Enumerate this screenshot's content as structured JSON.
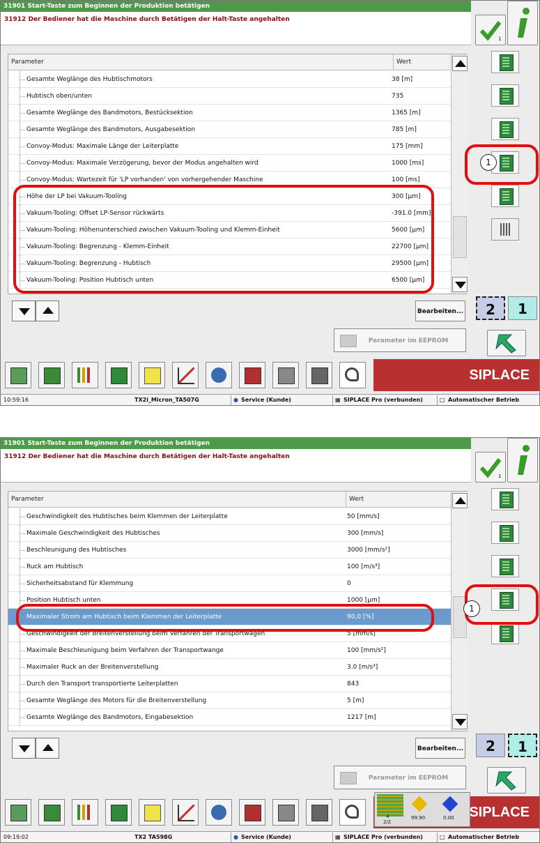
{
  "screen1": {
    "title": "31901 Start-Taste zum Beginnen der Produktion betätigen",
    "message": "31912 Der Bediener hat die Maschine durch Betätigen der Halt-Taste angehalten",
    "col_param": "Parameter",
    "col_value": "Wert",
    "rows": [
      {
        "name": "Gesamte Weglänge des Hubtischmotors",
        "value": "38 [m]"
      },
      {
        "name": "Hubtisch oben/unten",
        "value": "735"
      },
      {
        "name": "Gesamte Weglänge des Bandmotors, Bestücksektion",
        "value": "1365 [m]"
      },
      {
        "name": "Gesamte Weglänge des Bandmotors, Ausgabesektion",
        "value": "785 [m]"
      },
      {
        "name": "Convoy-Modus: Maximale Länge der Leiterplatte",
        "value": "175 [mm]"
      },
      {
        "name": "Convoy-Modus: Maximale Verzögerung, bevor der Modus angehalten wird",
        "value": "1000 [ms]"
      },
      {
        "name": "Convoy-Modus: Wartezeit für 'LP vorhanden' von vorhergehender Maschine",
        "value": "100 [ms]"
      },
      {
        "name": "Höhe der LP bei Vakuum-Tooling",
        "value": "300 [µm]"
      },
      {
        "name": "Vakuum-Tooling: Offset LP-Sensor rückwärts",
        "value": "-391.0 [mm]"
      },
      {
        "name": "Vakuum-Tooling: Höhenunterschied zwischen Vakuum-Tooling und Klemm-Einheit",
        "value": "5600 [µm]"
      },
      {
        "name": "Vakuum-Tooling: Begrenzung - Klemm-Einheit",
        "value": "22700 [µm]"
      },
      {
        "name": "Vakuum-Tooling: Begrenzung - Hubtisch",
        "value": "29500 [µm]"
      },
      {
        "name": "Vakuum-Tooling: Position Hubtisch unten",
        "value": "6500 [µm]"
      }
    ],
    "edit_label": "Bearbeiten...",
    "eeprom_label": "Parameter im EEPROM speichern",
    "page_2": "2",
    "page_1": "1",
    "check_sub": "1",
    "callout": "1",
    "brand": "SIPLACE",
    "status": {
      "time": "10:59:16",
      "machine": "TX2i_Micron_TA507G",
      "user": "Service (Kunde)",
      "connection": "SIPLACE Pro (verbunden)",
      "mode": "Automatischer Betrieb"
    }
  },
  "screen2": {
    "title": "31901 Start-Taste zum Beginnen der Produktion betätigen",
    "message": "31912 Der Bediener hat die Maschine durch Betätigen der Halt-Taste angehalten",
    "col_param": "Parameter",
    "col_value": "Wert",
    "rows": [
      {
        "name": "Geschwindigkeit des Hubtisches beim Klemmen der Leiterplatte",
        "value": "50 [mm/s]"
      },
      {
        "name": "Maximale Geschwindigkeit des Hubtisches",
        "value": "300 [mm/s]"
      },
      {
        "name": "Beschleunigung des Hubtisches",
        "value": "3000 [mm/s²]"
      },
      {
        "name": "Ruck am Hubtisch",
        "value": "100 [m/s³]"
      },
      {
        "name": "Sicherheitsabstand für Klemmung",
        "value": "0"
      },
      {
        "name": "Position Hubtisch unten",
        "value": "1000 [µm]"
      },
      {
        "name": "Maximaler Strom am Hubtisch beim Klemmen der Leiterplatte",
        "value": "90,0  [%]"
      },
      {
        "name": "Geschwindigkeit der Breitenverstellung beim Verfahren der Transportwagen",
        "value": "5 [mm/s]"
      },
      {
        "name": "Maximale Beschleunigung beim Verfahren der Transportwange",
        "value": "100 [mm/s²]"
      },
      {
        "name": "Maximaler Ruck an der Breitenverstellung",
        "value": "3.0 [m/s³]"
      },
      {
        "name": "Durch den Transport transportierte Leiterplatten",
        "value": "843"
      },
      {
        "name": "Gesamte Weglänge des Motors für die Breitenverstellung",
        "value": "5 [m]"
      },
      {
        "name": "Gesamte Weglänge des Bandmotors, Eingabesektion",
        "value": "1217 [m]"
      }
    ],
    "edit_label": "Bearbeiten...",
    "eeprom_label": "Parameter im EEPROM speichern",
    "page_2": "2",
    "page_1": "1",
    "check_sub": "1",
    "callout": "1",
    "brand": "SIPLACE",
    "mini": {
      "a": "4",
      "b": "2/2",
      "c": "99.90",
      "d": "0.00"
    },
    "status": {
      "time": "09:19:02",
      "machine": "TX2 TA598G",
      "user": "Service (Kunde)",
      "connection": "SIPLACE Pro (verbunden)",
      "mode": "Automatischer Betrieb"
    }
  }
}
